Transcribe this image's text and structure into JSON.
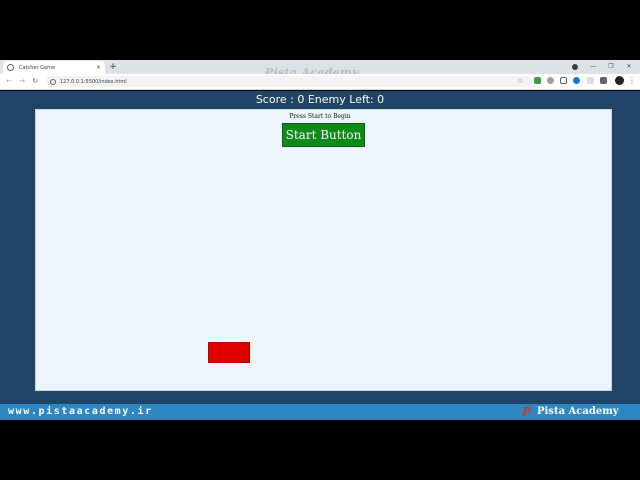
{
  "browser": {
    "tab_title": "Catcher Game",
    "tab_close": "×",
    "new_tab": "+",
    "url": "127.0.0.1:5500/index.html",
    "watermark": "Pista Academy",
    "window_controls": [
      "—",
      "❐",
      "✕"
    ]
  },
  "hud": {
    "score_label": "Score : 0",
    "enemy_label": "Enemy Left: 0"
  },
  "game": {
    "hint": "Press Start to Begin",
    "start_label": "Start Button",
    "catcher_color": "#e00000",
    "start_color": "#0d8a1a",
    "board_color": "#eef5fd",
    "page_color": "#1f4465"
  },
  "banner": {
    "url": "www.pistaacademy.ir",
    "logo": "P",
    "brand": "Pista Academy",
    "color": "#2e86c1"
  },
  "icons": {
    "back": "←",
    "forward": "→",
    "reload": "↻",
    "star": "☆",
    "menu": "⋮"
  }
}
